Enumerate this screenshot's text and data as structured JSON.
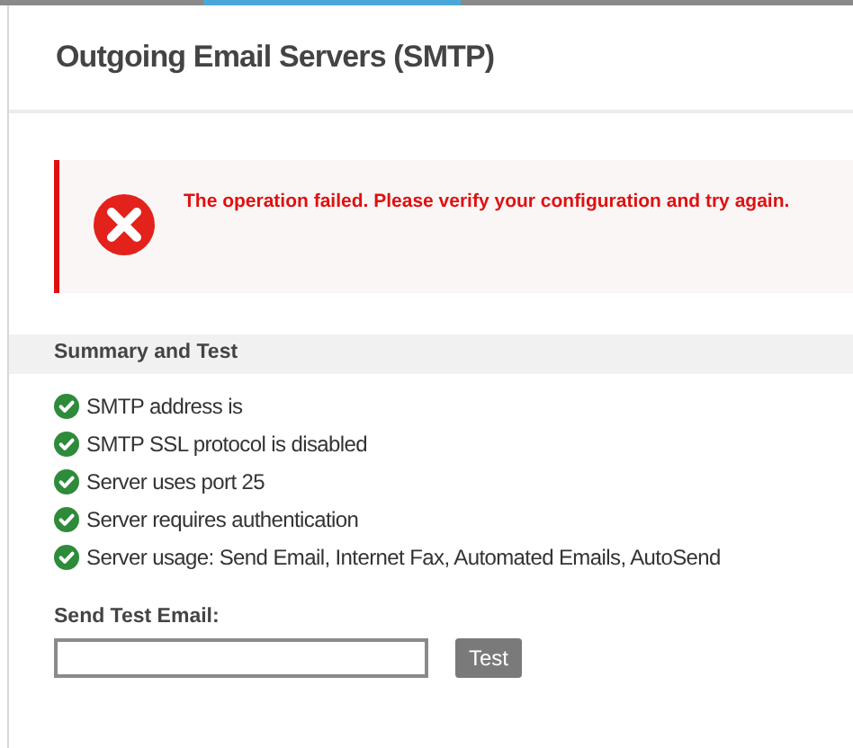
{
  "page": {
    "title": "Outgoing Email Servers (SMTP)"
  },
  "alert": {
    "kind": "error",
    "message": "The operation failed. Please verify your configuration and try again."
  },
  "summary": {
    "heading": "Summary and Test",
    "items": [
      {
        "text": "SMTP address is",
        "passed": true
      },
      {
        "text": "SMTP SSL protocol is disabled",
        "passed": true
      },
      {
        "text": "Server uses port 25",
        "passed": true
      },
      {
        "text": "Server requires authentication",
        "passed": true
      },
      {
        "text": "Server usage: Send Email, Internet Fax, Automated Emails, AutoSend",
        "passed": true
      }
    ]
  },
  "test_email": {
    "label": "Send Test Email:",
    "button": "Test"
  }
}
